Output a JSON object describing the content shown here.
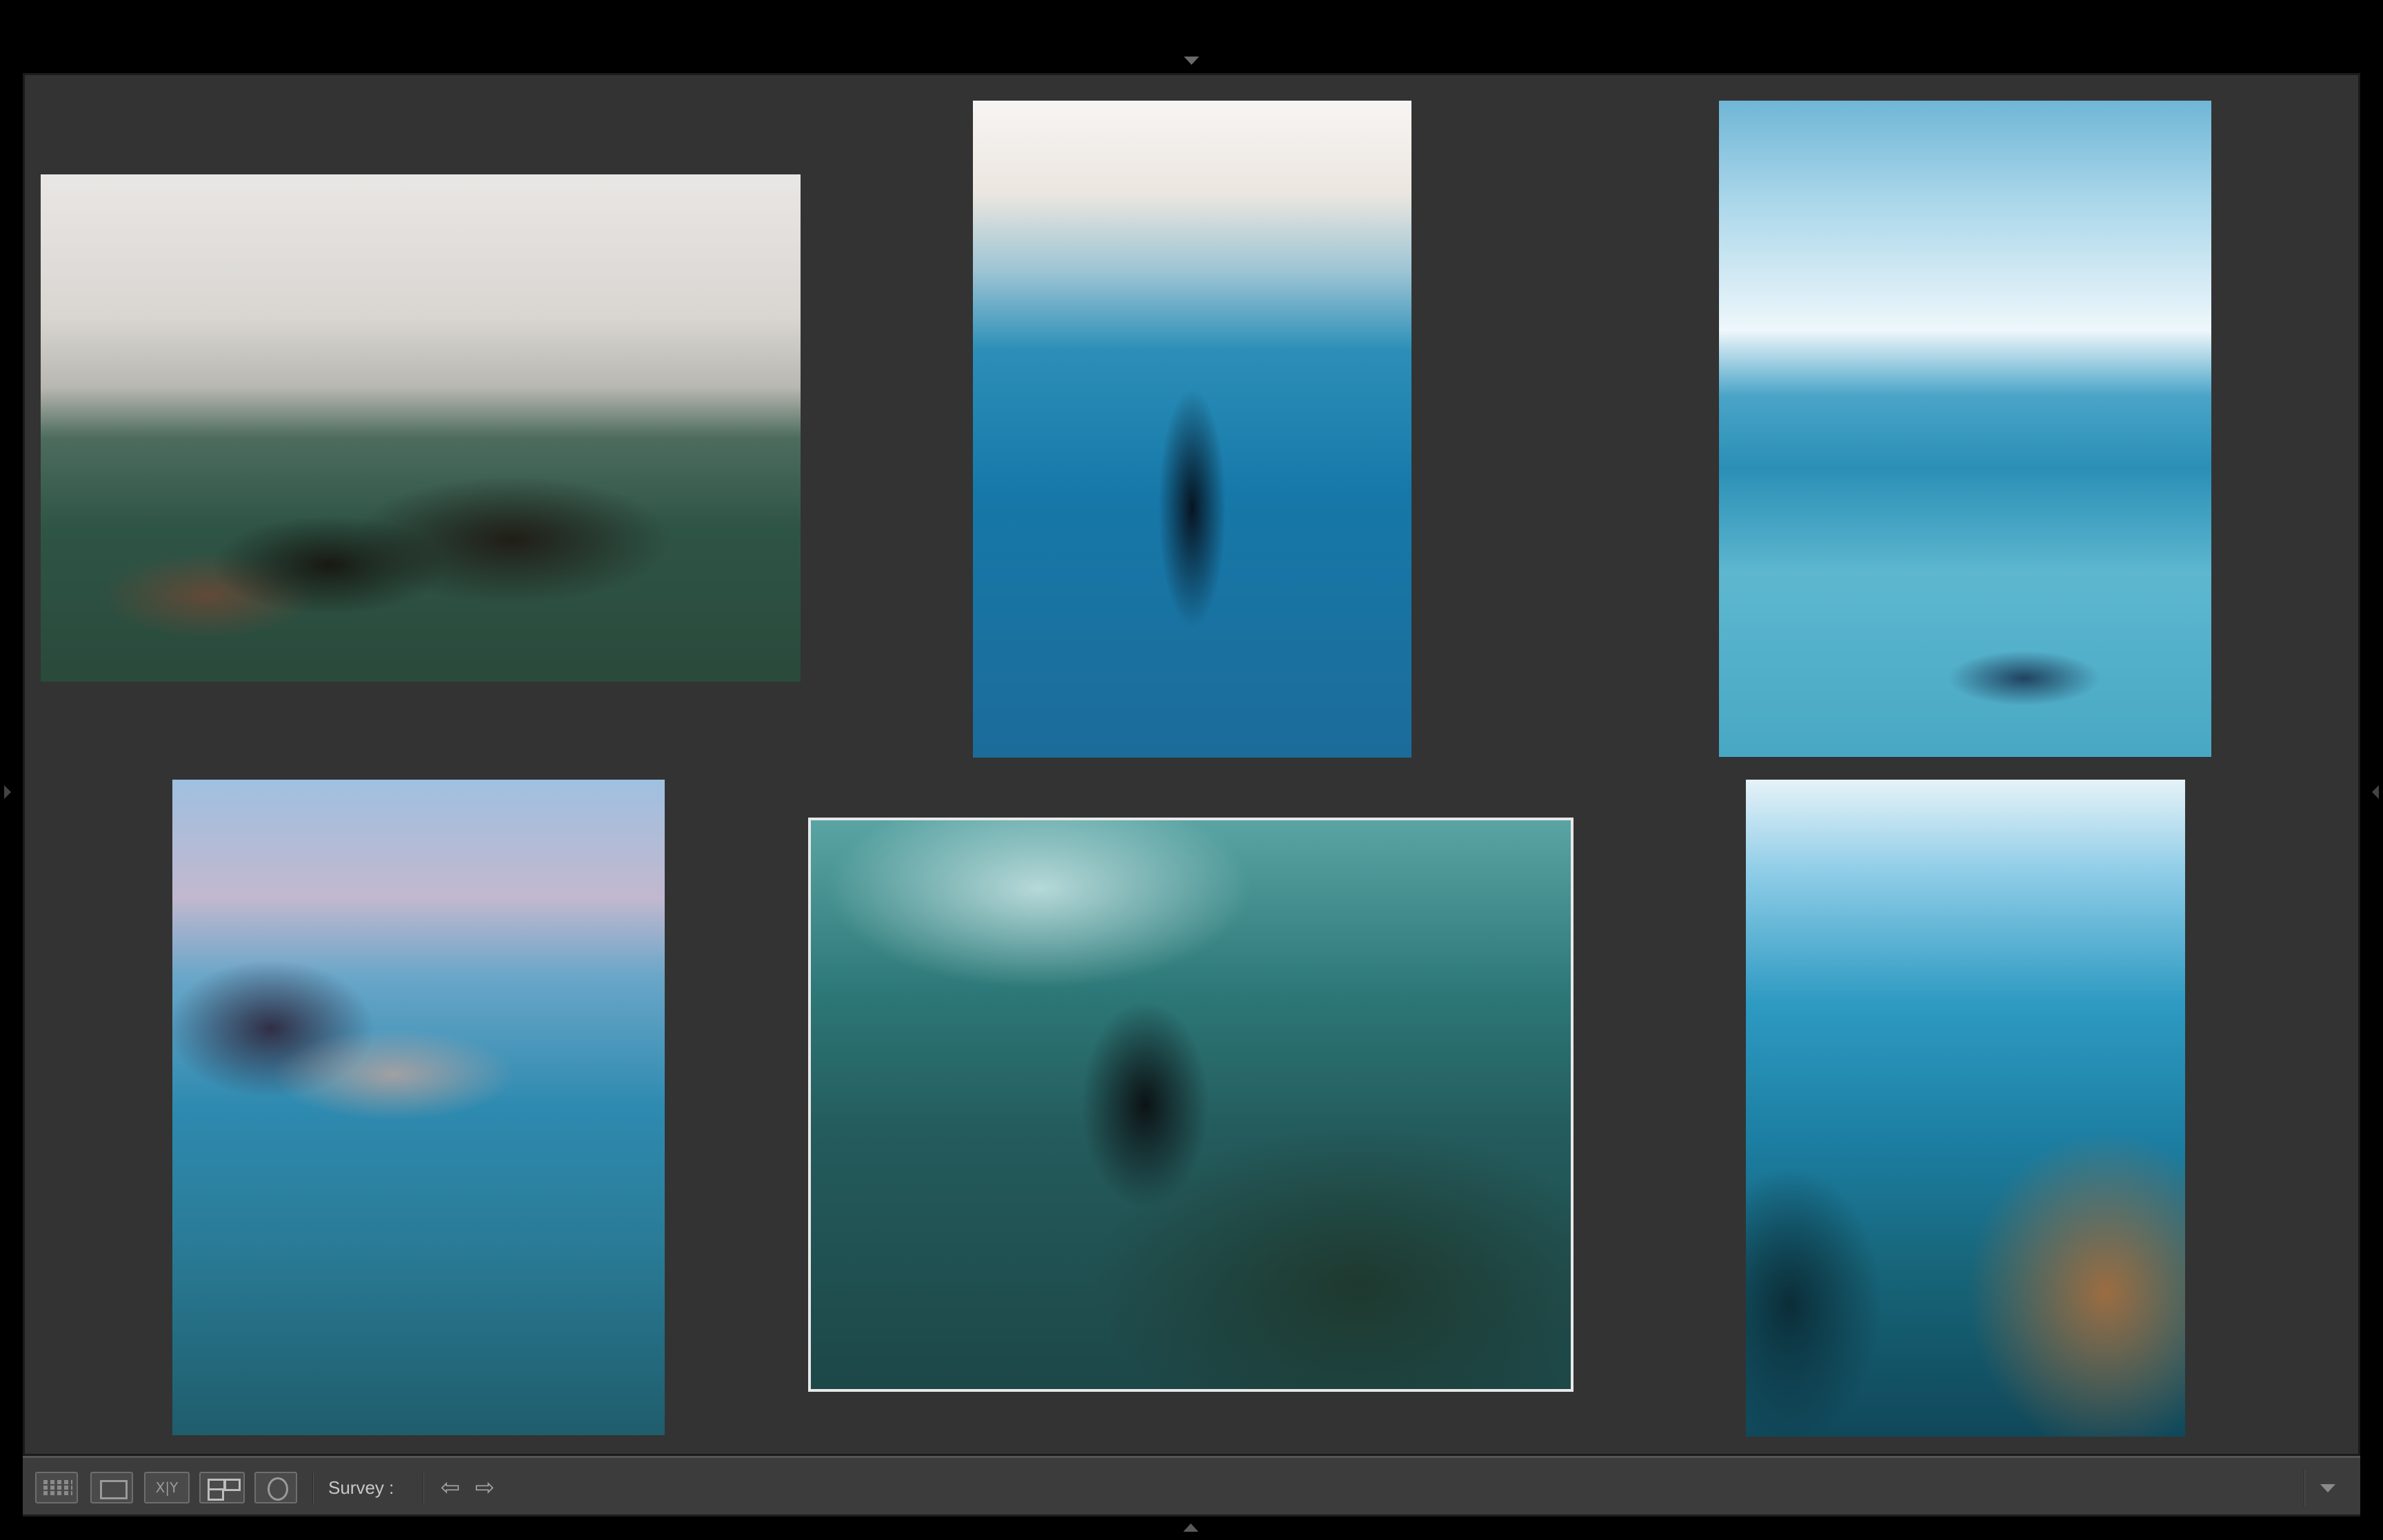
{
  "toolbar": {
    "view_label": "Survey :",
    "compare_glyph": "X|Y",
    "prev_glyph": "⇦",
    "next_glyph": "⇨"
  },
  "photos": [
    {
      "id": "photo-1",
      "subject": "swimmers at surface",
      "selected": false
    },
    {
      "id": "photo-2",
      "subject": "freediver ascending",
      "selected": false
    },
    {
      "id": "photo-3",
      "subject": "diver over sand",
      "selected": false
    },
    {
      "id": "photo-4",
      "subject": "snorkeler with fins",
      "selected": false
    },
    {
      "id": "photo-5",
      "subject": "diver in cave light",
      "selected": true
    },
    {
      "id": "photo-6",
      "subject": "diver near reef wall",
      "selected": false
    }
  ],
  "colors": {
    "background": "#333333",
    "selection_border": "#e8e8e8",
    "toolbar": "#3c3c3c"
  }
}
